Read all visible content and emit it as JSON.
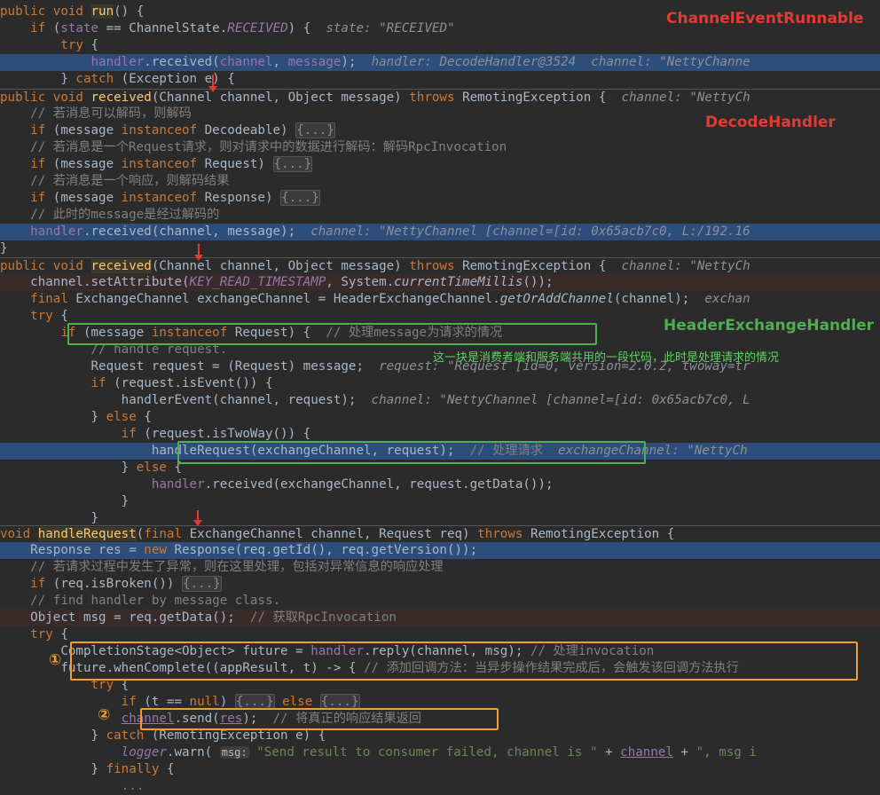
{
  "labels": {
    "channel_event_runnable": "ChannelEventRunnable",
    "decode_handler": "DecodeHandler",
    "header_exchange_handler": "HeaderExchangeHandler",
    "shared_code_note": "这一块是消费者端和服务端共用的一段代码，此时是处理请求的情况",
    "step1": "①",
    "step2": "②"
  },
  "comments": {
    "decode_if_decodeable": "// 若消息可以解码，则解码",
    "request_decode_rpc": "// 若消息是一个Request请求，则对请求中的数据进行解码：解码RpcInvocation",
    "response_decode": "// 若消息是一个响应，则解码结果",
    "message_decoded": "// 此时的message是经过解码的",
    "handle_request_msg": "// 处理message为请求的情况",
    "handle_request_tag": "// 处理请求",
    "exception_handle": "// 若请求过程中发生了异常，则在这里处理，包括对异常信息的响应处理",
    "get_rpc_invocation": "// 获取RpcInvocation",
    "handle_invocation": "// 处理invocation",
    "add_callback": "// 添加回调方法：当异步操作结果完成后，会触发该回调方法执行",
    "return_response": "// 将真正的响应结果返回"
  },
  "hints": {
    "state_received": "state: \"RECEIVED\"",
    "handler_decode": "handler: DecodeHandler@3524",
    "channel_netty_run": "channel: \"NettyChanne",
    "channel_netty_decode_sig": "channel: \"NettyCh",
    "channel_netty_decode_call": "channel: \"NettyChannel [channel=[id: 0x65acb7c0, L:/192.16",
    "channel_netty_hx_sig": "channel: \"NettyCh",
    "exchange_hint": "exchan",
    "request_hint": "request: \"Request [id=0, version=2.0.2, twoway=tr",
    "channel_netty_event": "channel: \"NettyChannel [channel=[id: 0x65acb7c0, L",
    "exchange_channel_hint": "exchangeChannel: \"NettyCh"
  },
  "strings": {
    "send_failed": "\"Send result to consumer failed, channel is \"",
    "msg_suffix": "\", msg i",
    "param_msg": "msg:"
  },
  "code": {
    "public_void": "public void",
    "run": "run",
    "received": "received",
    "handle_request": "handleRequest",
    "throws": "throws",
    "remoting_exception": "RemotingException",
    "channel_state_received": "RECEIVED",
    "key_read_timestamp": "KEY_READ_TIMESTAMP",
    "handle_request_comment_en": "// handle request.",
    "find_handler_comment": "// find handler by message class."
  },
  "colors": {
    "background": "#2b2b2b",
    "highlight_line": "#2d4d7b",
    "red_label": "#e53935",
    "green_label": "#4caf50",
    "orange_box": "#f39c34"
  }
}
